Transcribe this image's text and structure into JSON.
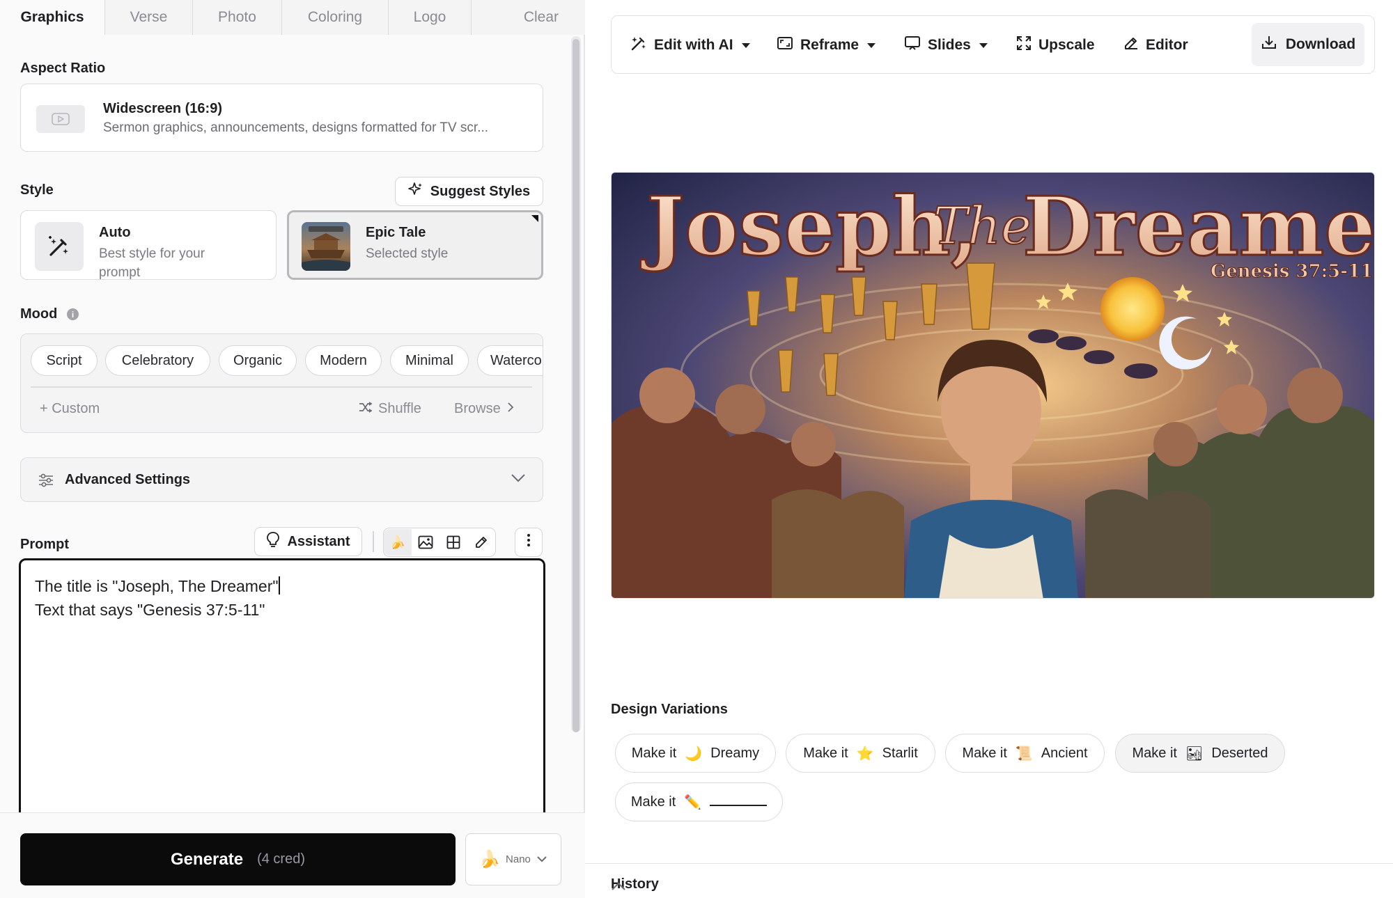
{
  "tabs": [
    "Graphics",
    "Verse",
    "Photo",
    "Coloring",
    "Logo",
    "Clear"
  ],
  "aspect_ratio": {
    "label": "Aspect Ratio",
    "title": "Widescreen (16:9)",
    "description": "Sermon graphics, announcements, designs formatted for TV scr..."
  },
  "style": {
    "label": "Style",
    "suggest_label": "Suggest Styles",
    "auto_name": "Auto",
    "auto_sub": "Best style for your prompt",
    "selected_name": "Epic Tale",
    "selected_sub": "Selected style"
  },
  "mood": {
    "label": "Mood",
    "chips": [
      "Script",
      "Celebratory",
      "Organic",
      "Modern",
      "Minimal",
      "Waterco"
    ],
    "custom": "+ Custom",
    "shuffle": "Shuffle",
    "browse": "Browse"
  },
  "advanced": {
    "label": "Advanced Settings"
  },
  "prompt": {
    "label": "Prompt",
    "assistant": "Assistant",
    "line1": "The title is \"Joseph, The Dreamer\"",
    "line2": "Text that says \"Genesis 37:5-11\""
  },
  "generate": {
    "label": "Generate",
    "cost": "(4 cred)",
    "model": "Nano"
  },
  "toolbar": {
    "edit_ai": "Edit with AI",
    "reframe": "Reframe",
    "slides": "Slides",
    "upscale": "Upscale",
    "editor": "Editor",
    "download": "Download"
  },
  "artwork": {
    "title_left": "Joseph,",
    "title_the": "The",
    "title_right": "Dreamer",
    "reference": "Genesis 37:5-11"
  },
  "variations": {
    "title": "Design Variations",
    "prefix": "Make it",
    "items": [
      {
        "emoji": "🌙",
        "word": "Dreamy"
      },
      {
        "emoji": "⭐",
        "word": "Starlit"
      },
      {
        "emoji": "📜",
        "word": "Ancient"
      },
      {
        "emoji": "🏜",
        "word": "Deserted"
      },
      {
        "emoji": "✏️",
        "word": ""
      }
    ]
  },
  "history": {
    "label": "History"
  }
}
